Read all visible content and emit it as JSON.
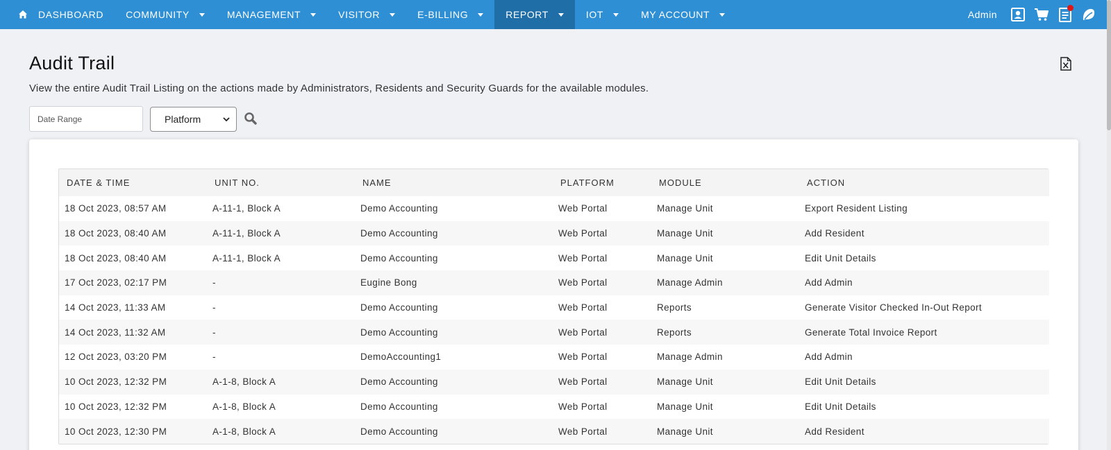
{
  "nav": {
    "items": [
      {
        "label": "DASHBOARD",
        "has_caret": false,
        "active": false
      },
      {
        "label": "COMMUNITY",
        "has_caret": true,
        "active": false
      },
      {
        "label": "MANAGEMENT",
        "has_caret": true,
        "active": false
      },
      {
        "label": "VISITOR",
        "has_caret": true,
        "active": false
      },
      {
        "label": "E-BILLING",
        "has_caret": true,
        "active": false
      },
      {
        "label": "REPORT",
        "has_caret": true,
        "active": true
      },
      {
        "label": "IOT",
        "has_caret": true,
        "active": false
      },
      {
        "label": "MY ACCOUNT",
        "has_caret": true,
        "active": false
      }
    ],
    "user_label": "Admin",
    "icons": [
      "home-icon",
      "profile-icon",
      "cart-icon",
      "document-icon",
      "leaf-icon"
    ],
    "colors": {
      "bar": "#2f8fd4",
      "active": "#1f6ea8",
      "notification": "#e01717"
    }
  },
  "page": {
    "title": "Audit Trail",
    "description": "View the entire Audit Trail Listing on the actions made by Administrators, Residents and Security Guards for the available modules."
  },
  "filters": {
    "date_placeholder": "Date Range",
    "platform_selected": "Platform"
  },
  "table": {
    "columns": [
      "DATE & TIME",
      "UNIT NO.",
      "NAME",
      "PLATFORM",
      "MODULE",
      "ACTION"
    ],
    "rows": [
      [
        "18 Oct 2023, 08:57 AM",
        "A-11-1, Block A",
        "Demo Accounting",
        "Web Portal",
        "Manage Unit",
        "Export Resident Listing"
      ],
      [
        "18 Oct 2023, 08:40 AM",
        "A-11-1, Block A",
        "Demo Accounting",
        "Web Portal",
        "Manage Unit",
        "Add Resident"
      ],
      [
        "18 Oct 2023, 08:40 AM",
        "A-11-1, Block A",
        "Demo Accounting",
        "Web Portal",
        "Manage Unit",
        "Edit Unit Details"
      ],
      [
        "17 Oct 2023, 02:17 PM",
        "-",
        "Eugine Bong",
        "Web Portal",
        "Manage Admin",
        "Add Admin"
      ],
      [
        "14 Oct 2023, 11:33 AM",
        "-",
        "Demo Accounting",
        "Web Portal",
        "Reports",
        "Generate Visitor Checked In-Out Report"
      ],
      [
        "14 Oct 2023, 11:32 AM",
        "-",
        "Demo Accounting",
        "Web Portal",
        "Reports",
        "Generate Total Invoice Report"
      ],
      [
        "12 Oct 2023, 03:20 PM",
        "-",
        "DemoAccounting1",
        "Web Portal",
        "Manage Admin",
        "Add Admin"
      ],
      [
        "10 Oct 2023, 12:32 PM",
        "A-1-8, Block A",
        "Demo Accounting",
        "Web Portal",
        "Manage Unit",
        "Edit Unit Details"
      ],
      [
        "10 Oct 2023, 12:32 PM",
        "A-1-8, Block A",
        "Demo Accounting",
        "Web Portal",
        "Manage Unit",
        "Edit Unit Details"
      ],
      [
        "10 Oct 2023, 12:30 PM",
        "A-1-8, Block A",
        "Demo Accounting",
        "Web Portal",
        "Manage Unit",
        "Add Resident"
      ]
    ]
  }
}
